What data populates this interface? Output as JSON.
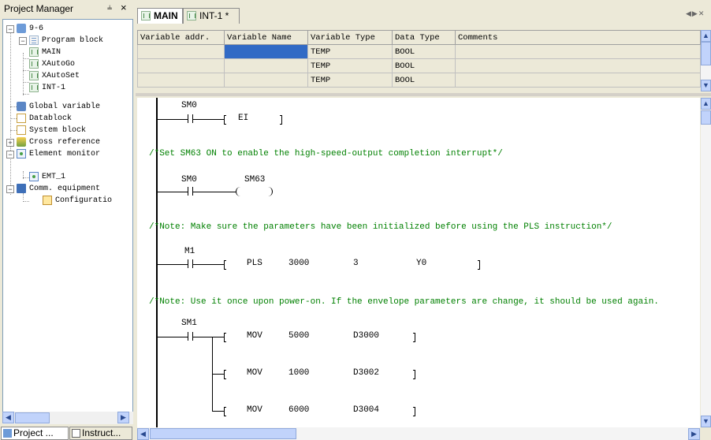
{
  "project_manager": {
    "title": "Project Manager",
    "pin_glyph": "ᵖ",
    "close_glyph": "×",
    "tree": [
      {
        "label": "9-6",
        "icon": "project-icon"
      },
      {
        "label": "Program block",
        "icon": "program-block-icon"
      },
      {
        "label": "MAIN",
        "icon": "ladder-program-icon"
      },
      {
        "label": "XAutoGo",
        "icon": "ladder-program-icon"
      },
      {
        "label": "XAutoSet",
        "icon": "ladder-program-icon"
      },
      {
        "label": "INT-1",
        "icon": "ladder-program-icon"
      },
      {
        "label": "Global variable",
        "icon": "global-variable-icon"
      },
      {
        "label": "Datablock",
        "icon": "datablock-icon"
      },
      {
        "label": "System block",
        "icon": "system-block-icon"
      },
      {
        "label": "Cross reference",
        "icon": "cross-reference-icon"
      },
      {
        "label": "Element monitor",
        "icon": "element-monitor-icon"
      },
      {
        "label": "EMT_1",
        "icon": "monitor-table-icon"
      },
      {
        "label": "Comm. equipment",
        "icon": "comm-equipment-icon"
      },
      {
        "label": "Configuratio",
        "icon": "configuration-icon"
      }
    ],
    "bottom_tabs": [
      "Project ...",
      "Instruct..."
    ]
  },
  "editor_tabs": [
    {
      "label": "MAIN",
      "active": true
    },
    {
      "label": "INT-1 *",
      "active": false
    }
  ],
  "variable_table": {
    "columns": [
      "Variable addr.",
      "Variable Name",
      "Variable Type",
      "Data Type",
      "Comments"
    ],
    "rows": [
      [
        "",
        "",
        "TEMP",
        "BOOL",
        ""
      ],
      [
        "",
        "",
        "TEMP",
        "BOOL",
        ""
      ],
      [
        "",
        "",
        "TEMP",
        "BOOL",
        ""
      ]
    ]
  },
  "ladder": {
    "rung1": {
      "contact": "SM0",
      "instr": "EI"
    },
    "comment1": "/*Set SM63 ON to enable the high-speed-output completion interrupt*/",
    "rung2": {
      "contact": "SM0",
      "coil": "SM63"
    },
    "comment2": "/*Note: Make sure the parameters have been initialized before using the PLS instruction*/",
    "rung3": {
      "contact": "M1",
      "instr": "PLS",
      "op1": "3000",
      "op2": "3",
      "op3": "Y0"
    },
    "comment3": "/*Note: Use it once upon power-on. If the envelope parameters are change, it should be used again.",
    "rung4": {
      "contact": "SM1",
      "rows": [
        {
          "instr": "MOV",
          "op1": "5000",
          "op2": "D3000"
        },
        {
          "instr": "MOV",
          "op1": "1000",
          "op2": "D3002"
        },
        {
          "instr": "MOV",
          "op1": "6000",
          "op2": "D3004"
        }
      ]
    }
  },
  "colors": {
    "comment": "#008000",
    "selection": "#316ac5",
    "tab_bg": "#ece9d8"
  }
}
